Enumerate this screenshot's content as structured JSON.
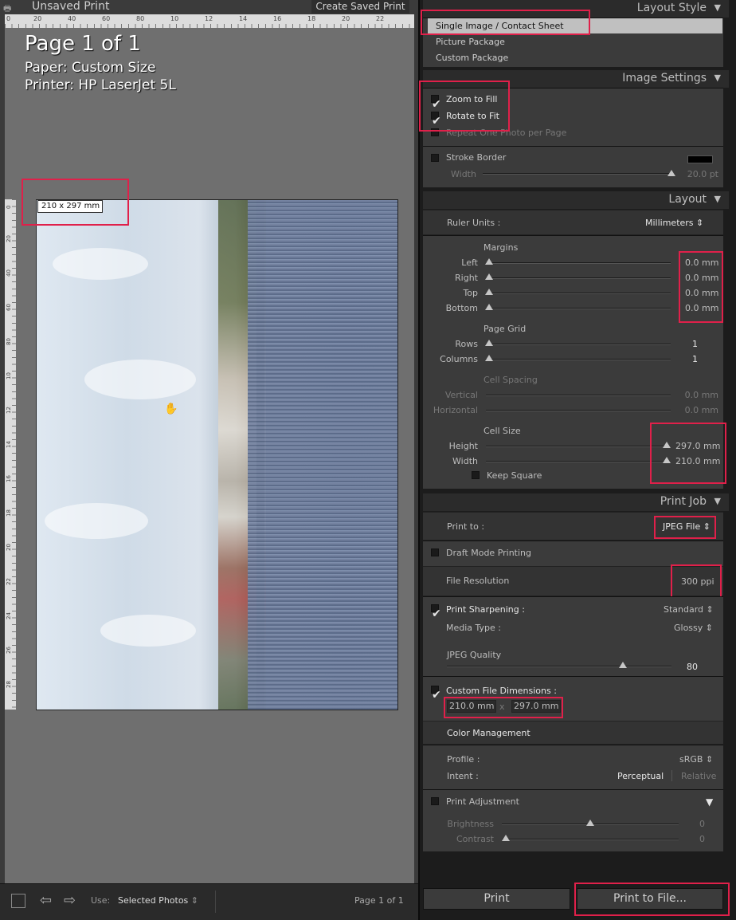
{
  "toolbar": {
    "title": "Unsaved Print",
    "create_saved": "Create Saved Print"
  },
  "ruler_top": [
    "0",
    "20",
    "40",
    "60",
    "80",
    "10",
    "12",
    "14",
    "16",
    "18",
    "20",
    "22"
  ],
  "ruler_left": [
    "0",
    "20",
    "40",
    "60",
    "80",
    "10",
    "12",
    "14",
    "16",
    "18",
    "20",
    "22",
    "24",
    "26",
    "28"
  ],
  "page_info": {
    "page": "Page 1 of 1",
    "paper": "Paper:  Custom Size",
    "printer": "Printer:  HP LaserJet 5L"
  },
  "photo": {
    "size_badge": "210 x 297 mm"
  },
  "bottom_bar": {
    "use_label": "Use:",
    "use_value": "Selected Photos",
    "page_status": "Page 1 of 1"
  },
  "layout_style": {
    "header": "Layout Style",
    "items": [
      "Single Image / Contact Sheet",
      "Picture Package",
      "Custom Package"
    ]
  },
  "image_settings": {
    "header": "Image Settings",
    "zoom_to_fill": "Zoom to Fill",
    "rotate_to_fit": "Rotate to Fit",
    "repeat_one": "Repeat One Photo per Page",
    "stroke_border": "Stroke Border",
    "width_label": "Width",
    "width_value": "20.0 pt"
  },
  "layout": {
    "header": "Layout",
    "ruler_units_label": "Ruler Units :",
    "ruler_units_value": "Millimeters",
    "margins_label": "Margins",
    "margins": [
      {
        "label": "Left",
        "value": "0.0",
        "unit": "mm"
      },
      {
        "label": "Right",
        "value": "0.0",
        "unit": "mm"
      },
      {
        "label": "Top",
        "value": "0.0",
        "unit": "mm"
      },
      {
        "label": "Bottom",
        "value": "0.0",
        "unit": "mm"
      }
    ],
    "page_grid_label": "Page Grid",
    "rows_label": "Rows",
    "rows_value": "1",
    "columns_label": "Columns",
    "columns_value": "1",
    "cell_spacing_label": "Cell Spacing",
    "vertical_label": "Vertical",
    "vertical_value": "0.0 mm",
    "horizontal_label": "Horizontal",
    "horizontal_value": "0.0 mm",
    "cell_size_label": "Cell Size",
    "height_label": "Height",
    "height_value": "297.0",
    "width_label": "Width",
    "width_value": "210.0",
    "unit": "mm",
    "keep_square": "Keep Square"
  },
  "print_job": {
    "header": "Print Job",
    "print_to_label": "Print to :",
    "print_to_value": "JPEG File",
    "draft_mode": "Draft Mode Printing",
    "file_resolution_label": "File Resolution",
    "file_resolution_value": "300",
    "file_resolution_unit": "ppi",
    "print_sharpening_label": "Print Sharpening :",
    "print_sharpening_value": "Standard",
    "media_type_label": "Media Type :",
    "media_type_value": "Glossy",
    "jpeg_quality_label": "JPEG Quality",
    "jpeg_quality_value": "80",
    "custom_dims_label": "Custom File Dimensions :",
    "dim_w": "210.0",
    "dim_h": "297.0",
    "dim_unit": "mm",
    "dim_x": "x",
    "color_management": "Color Management",
    "profile_label": "Profile :",
    "profile_value": "sRGB",
    "intent_label": "Intent :",
    "intent_perceptual": "Perceptual",
    "intent_relative": "Relative",
    "print_adjustment": "Print Adjustment",
    "brightness_label": "Brightness",
    "brightness_value": "0",
    "contrast_label": "Contrast",
    "contrast_value": "0"
  },
  "buttons": {
    "print": "Print",
    "print_to_file": "Print to File..."
  },
  "colors": {
    "highlight": "#e0204a",
    "panel": "#3b3b3b",
    "selection": "#c0c0c0"
  }
}
